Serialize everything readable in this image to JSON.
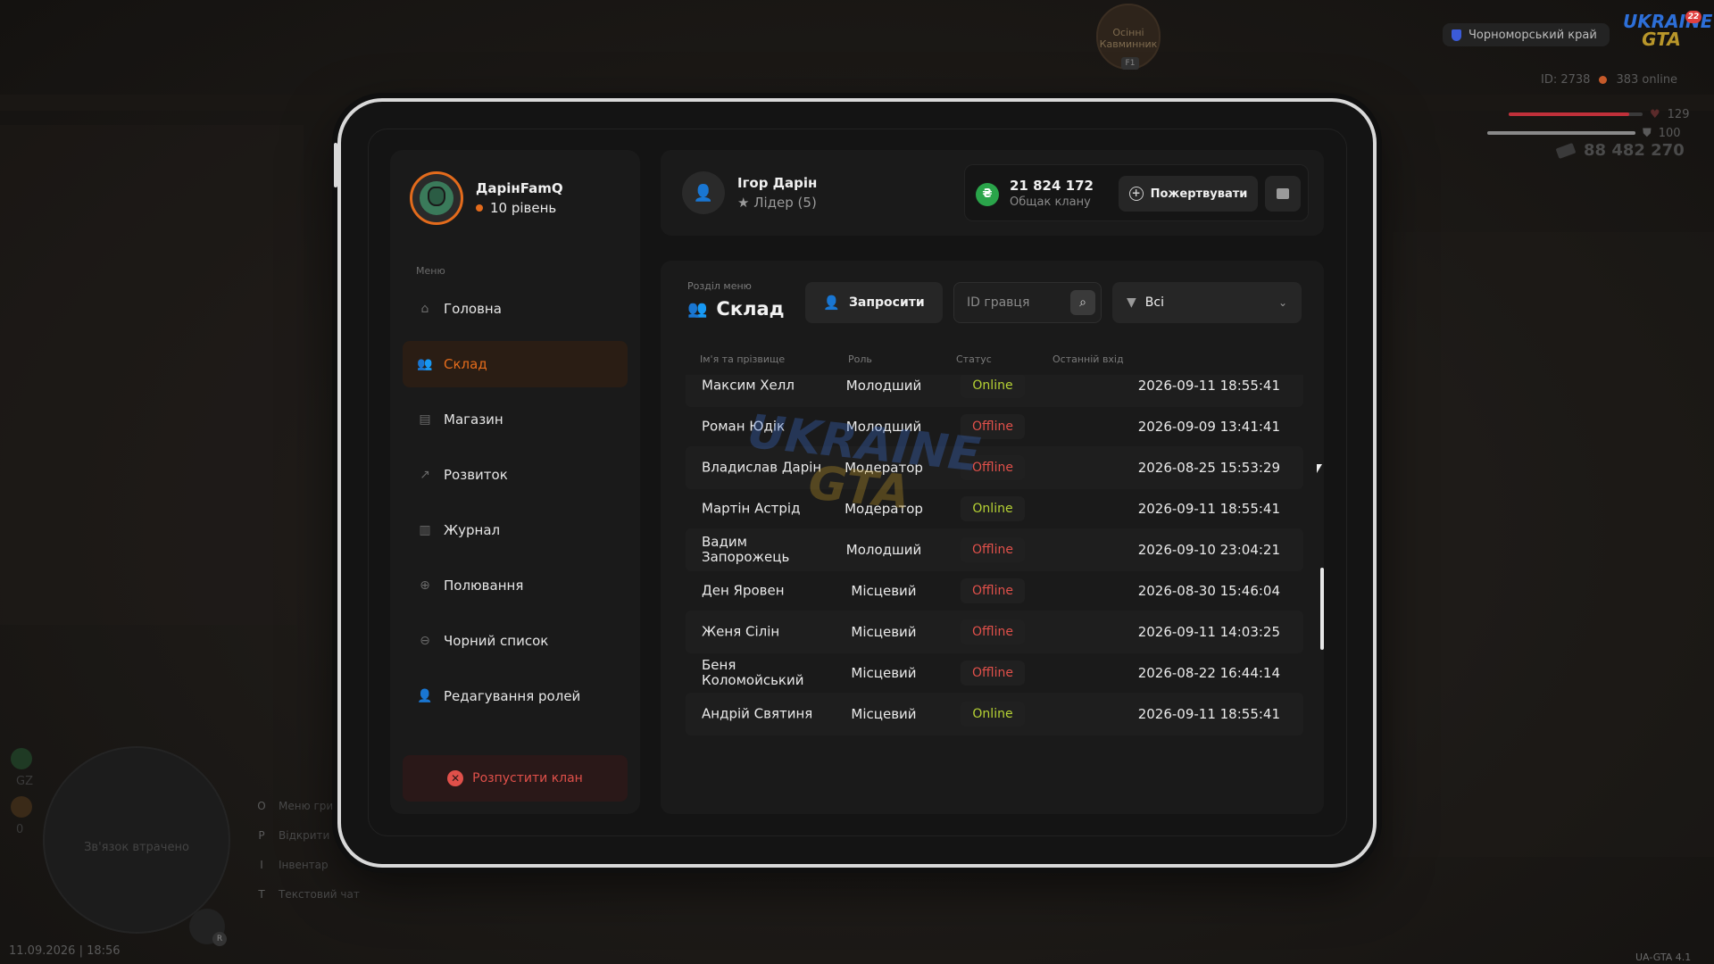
{
  "hud": {
    "server_name": "Чорноморський край",
    "logo_line1": "UKRAINE",
    "logo_line2": "GTA",
    "logo_level": "22",
    "player_id": "ID: 2738",
    "online": "383 online",
    "health": {
      "value": "129",
      "fraction": 0.9
    },
    "armor": {
      "value": "100",
      "fraction": 1.0
    },
    "money": "88 482 270",
    "badge_text": "Осінні Кавминник",
    "badge_key": "F1",
    "connection_lost": "Зв'язок втрачено",
    "minimap_num1": "GZ",
    "minimap_num2": "0",
    "hints": [
      {
        "key": "O",
        "label": "Меню гри"
      },
      {
        "key": "P",
        "label": "Відкрити т..."
      },
      {
        "key": "I",
        "label": "Інвентар"
      },
      {
        "key": "T",
        "label": "Текстовий чат"
      }
    ],
    "datetime": "11.09.2026 | 18:56",
    "version": "UA-GTA 4.1",
    "mic_key": "R",
    "watermark_line1": "UKRAINE",
    "watermark_line2": "GTA"
  },
  "sidebar": {
    "profile_name": "ДарінFamQ",
    "profile_level": "10 рівень",
    "menu_label": "Меню",
    "items": [
      {
        "label": "Головна",
        "icon": "home-icon",
        "active": false
      },
      {
        "label": "Склад",
        "icon": "people-icon",
        "active": true
      },
      {
        "label": "Магазин",
        "icon": "shop-basket-icon",
        "active": false
      },
      {
        "label": "Розвиток",
        "icon": "chart-icon",
        "active": false
      },
      {
        "label": "Журнал",
        "icon": "book-icon",
        "active": false
      },
      {
        "label": "Полювання",
        "icon": "crosshair-icon",
        "active": false
      },
      {
        "label": "Чорний список",
        "icon": "block-icon",
        "active": false
      },
      {
        "label": "Редагування ролей",
        "icon": "user-edit-icon",
        "active": false
      }
    ],
    "dissolve_label": "Розпустити клан"
  },
  "topbar": {
    "leader_name": "Ігор Дарін",
    "leader_role": "Лідер (5)",
    "funds_amount": "21 824 172",
    "funds_label": "Общак клану",
    "donate_label": "Пожертвувати"
  },
  "panel": {
    "section_label": "Розділ меню",
    "section_title": "Склад",
    "invite_label": "Запросити",
    "search_placeholder": "ID гравця",
    "filter_value": "Всі",
    "columns": [
      "Ім'я та прізвище",
      "Роль",
      "Статус",
      "Останній вхід"
    ],
    "rows": [
      {
        "name": "Максим Хелл",
        "role": "Молодший",
        "status": "Online",
        "last": "2026-09-11 18:55:41"
      },
      {
        "name": "Роман Юдік",
        "role": "Молодший",
        "status": "Offline",
        "last": "2026-09-09 13:41:41"
      },
      {
        "name": "Владислав Дарін",
        "role": "Модератор",
        "status": "Offline",
        "last": "2026-08-25 15:53:29"
      },
      {
        "name": "Мартін Астрід",
        "role": "Модератор",
        "status": "Online",
        "last": "2026-09-11 18:55:41"
      },
      {
        "name": "Вадим Запорожець",
        "role": "Молодший",
        "status": "Offline",
        "last": "2026-09-10 23:04:21"
      },
      {
        "name": "Ден Яровен",
        "role": "Місцевий",
        "status": "Offline",
        "last": "2026-08-30 15:46:04"
      },
      {
        "name": "Женя Сілін",
        "role": "Місцевий",
        "status": "Offline",
        "last": "2026-09-11 14:03:25"
      },
      {
        "name": "Беня Коломойський",
        "role": "Місцевий",
        "status": "Offline",
        "last": "2026-08-22 16:44:14"
      },
      {
        "name": "Андрій Святиня",
        "role": "Місцевий",
        "status": "Online",
        "last": "2026-09-11 18:55:41"
      }
    ]
  },
  "colors": {
    "accent": "#e36b1c",
    "online": "#b6d234",
    "offline": "#e0504a",
    "funds_coin": "#2aa44a"
  }
}
